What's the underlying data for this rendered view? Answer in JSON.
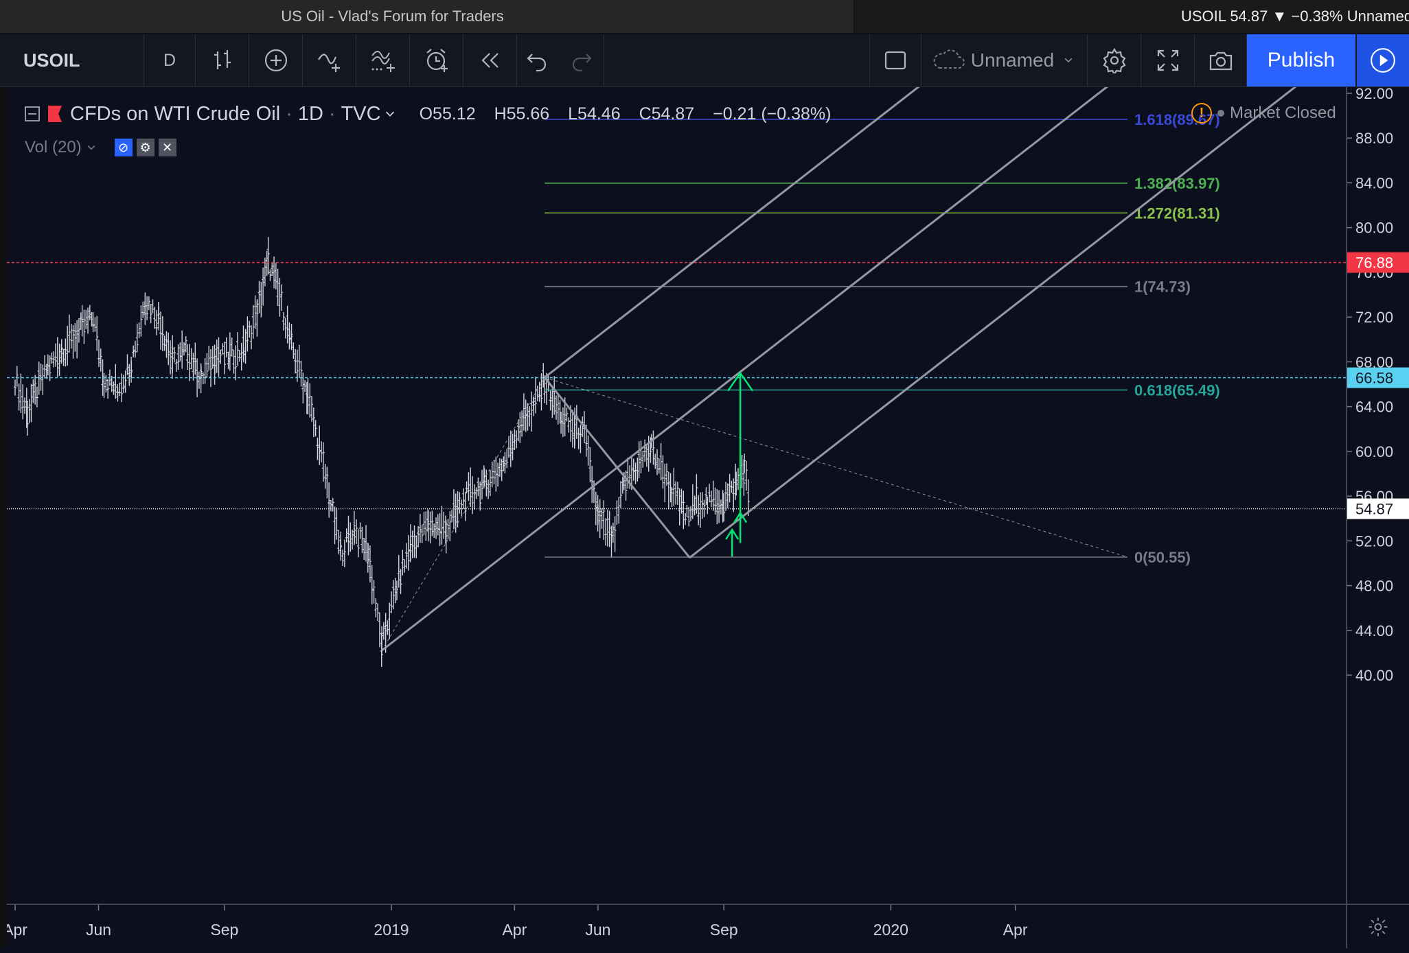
{
  "browser": {
    "tab_title": "US Oil - Vlad's Forum for Traders",
    "ticker_summary": "USOIL 54.87 ▼ −0.38% Unnamed"
  },
  "toolbar": {
    "symbol": "USOIL",
    "interval": "D",
    "layout_name": "Unnamed",
    "publish_label": "Publish",
    "icons": [
      "bar-style-icon",
      "compare-icon",
      "indicators-icon",
      "templates-icon",
      "alert-icon",
      "replay-icon",
      "undo-icon",
      "redo-icon",
      "layout-icon",
      "cloud-icon",
      "settings-icon",
      "fullscreen-icon",
      "snapshot-icon",
      "play-icon"
    ]
  },
  "legend": {
    "title": "CFDs on WTI Crude Oil",
    "sep1": "·",
    "interval": "1D",
    "sep2": "·",
    "source": "TVC",
    "open": "O55.12",
    "high": "H55.66",
    "low": "L54.46",
    "close": "C54.87",
    "change": "−0.21 (−0.38%)",
    "volume_label": "Vol (20)",
    "market_status": "Market Closed"
  },
  "chart_data": {
    "type": "candlestick",
    "symbol": "USOIL",
    "timeframe": "1D",
    "ylim": [
      38.5,
      93.5
    ],
    "y_ticks": [
      "92.00",
      "88.00",
      "84.00",
      "80.00",
      "76.00",
      "72.00",
      "68.00",
      "64.00",
      "60.00",
      "56.00",
      "52.00",
      "48.00",
      "44.00",
      "40.00"
    ],
    "x_ticks": [
      "Apr",
      "Jun",
      "Sep",
      "2019",
      "Apr",
      "Jun",
      "Sep",
      "2020",
      "Apr"
    ],
    "price_series": [
      [
        "2018-04-01",
        66.5
      ],
      [
        "2018-04-10",
        63.5
      ],
      [
        "2018-04-25",
        67.5
      ],
      [
        "2018-05-05",
        69.0
      ],
      [
        "2018-05-20",
        71.0
      ],
      [
        "2018-05-28",
        72.0
      ],
      [
        "2018-06-05",
        66.5
      ],
      [
        "2018-06-15",
        65.5
      ],
      [
        "2018-06-25",
        68.0
      ],
      [
        "2018-07-05",
        73.5
      ],
      [
        "2018-07-15",
        72.0
      ],
      [
        "2018-07-25",
        68.0
      ],
      [
        "2018-08-05",
        69.0
      ],
      [
        "2018-08-15",
        66.5
      ],
      [
        "2018-08-25",
        68.5
      ],
      [
        "2018-09-05",
        68.5
      ],
      [
        "2018-09-15",
        69.0
      ],
      [
        "2018-09-25",
        72.5
      ],
      [
        "2018-10-03",
        76.9
      ],
      [
        "2018-10-10",
        74.5
      ],
      [
        "2018-10-20",
        69.5
      ],
      [
        "2018-11-01",
        65.0
      ],
      [
        "2018-11-15",
        57.0
      ],
      [
        "2018-11-25",
        51.0
      ],
      [
        "2018-12-05",
        53.0
      ],
      [
        "2018-12-15",
        51.0
      ],
      [
        "2018-12-25",
        42.5
      ],
      [
        "2019-01-05",
        48.0
      ],
      [
        "2019-01-15",
        51.5
      ],
      [
        "2019-01-28",
        53.5
      ],
      [
        "2019-02-10",
        53.0
      ],
      [
        "2019-02-25",
        56.0
      ],
      [
        "2019-03-10",
        57.0
      ],
      [
        "2019-03-25",
        59.0
      ],
      [
        "2019-04-05",
        62.5
      ],
      [
        "2019-04-15",
        64.0
      ],
      [
        "2019-04-23",
        66.3
      ],
      [
        "2019-05-05",
        63.0
      ],
      [
        "2019-05-15",
        62.0
      ],
      [
        "2019-05-22",
        61.5
      ],
      [
        "2019-06-01",
        54.0
      ],
      [
        "2019-06-12",
        52.0
      ],
      [
        "2019-06-20",
        57.0
      ],
      [
        "2019-07-01",
        59.0
      ],
      [
        "2019-07-10",
        60.3
      ],
      [
        "2019-07-25",
        56.5
      ],
      [
        "2019-08-05",
        54.0
      ],
      [
        "2019-08-12",
        55.5
      ],
      [
        "2019-08-20",
        55.5
      ],
      [
        "2019-09-01",
        55.5
      ],
      [
        "2019-09-10",
        57.0
      ],
      [
        "2019-09-16",
        58.5
      ],
      [
        "2019-09-20",
        54.9
      ]
    ],
    "horizontal_lines": [
      {
        "price": 76.88,
        "label": "76.88",
        "color": "#f23645",
        "style": "dashed"
      },
      {
        "price": 66.58,
        "label": "66.58",
        "color": "#5ad1f0",
        "style": "dashed"
      },
      {
        "price": 54.87,
        "label": "54.87",
        "color": "#ffffff",
        "style": "dotted"
      }
    ],
    "fib_levels": [
      {
        "label": "1.618(89.67)",
        "price": 89.67,
        "color": "#3a49d6"
      },
      {
        "label": "1.382(83.97)",
        "price": 83.97,
        "color": "#4caf50"
      },
      {
        "label": "1.272(81.31)",
        "price": 81.31,
        "color": "#8bc34a"
      },
      {
        "label": "1(74.73)",
        "price": 74.73,
        "color": "#787b86"
      },
      {
        "label": "0.618(65.49)",
        "price": 65.49,
        "color": "#26a69a"
      },
      {
        "label": "0(50.55)",
        "price": 50.55,
        "color": "#787b86"
      }
    ],
    "pitchfork": {
      "p0": [
        "2018-12-25",
        42.2
      ],
      "p1": [
        "2019-04-23",
        66.6
      ],
      "p2": [
        "2019-08-07",
        50.5
      ],
      "color": "#9598a1"
    },
    "targets": {
      "arrow_to_price": 67.0,
      "arrow_from_price": 54.5,
      "color": "#00e676"
    }
  }
}
